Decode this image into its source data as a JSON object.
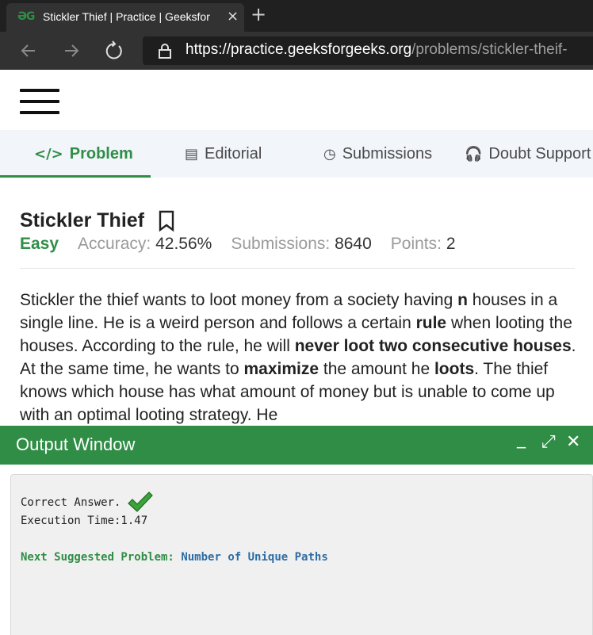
{
  "browser": {
    "tab_title": "Stickler Thief | Practice | Geeksfor",
    "favicon_text": "ƏG",
    "tab_close": "×",
    "new_tab": "+",
    "url_host": "https://practice.geeksforgeeks.org",
    "url_path": "/problems/stickler-theif-"
  },
  "tabs": [
    {
      "label": "Problem",
      "icon": "</>"
    },
    {
      "label": "Editorial",
      "icon": "▤"
    },
    {
      "label": "Submissions",
      "icon": "◷"
    },
    {
      "label": "Doubt Support",
      "icon": "🎧"
    }
  ],
  "problem": {
    "title": "Stickler Thief",
    "difficulty": "Easy",
    "accuracy_label": "Accuracy:",
    "accuracy_value": "42.56%",
    "submissions_label": "Submissions:",
    "submissions_value": "8640",
    "points_label": "Points:",
    "points_value": "2",
    "description": [
      {
        "text": "Stickler the thief wants to loot money from a society having ",
        "bold": false
      },
      {
        "text": "n",
        "bold": true
      },
      {
        "text": " houses in a single line. He is a weird person and follows a certain ",
        "bold": false
      },
      {
        "text": "rule",
        "bold": true
      },
      {
        "text": " when looting the houses. According to the rule, he will ",
        "bold": false
      },
      {
        "text": "never loot two consecutive houses",
        "bold": true
      },
      {
        "text": ". At the same time, he wants to ",
        "bold": false
      },
      {
        "text": "maximize",
        "bold": true
      },
      {
        "text": " the amount he ",
        "bold": false
      },
      {
        "text": "loots",
        "bold": true
      },
      {
        "text": ". The thief knows which house has what amount of money but is unable to come up with an optimal looting strategy. He",
        "bold": false
      }
    ]
  },
  "output": {
    "title": "Output Window",
    "minimize": "_",
    "expand": "⤢",
    "close": "✕",
    "correct": "Correct Answer.",
    "exec_time": "Execution Time:1.47",
    "next_label": "Next Suggested Problem:",
    "next_link": "Number of Unique Paths"
  },
  "colors": {
    "brand_green": "#2f8d46",
    "link_blue": "#2e6ca4",
    "chrome_dark": "#202020"
  }
}
